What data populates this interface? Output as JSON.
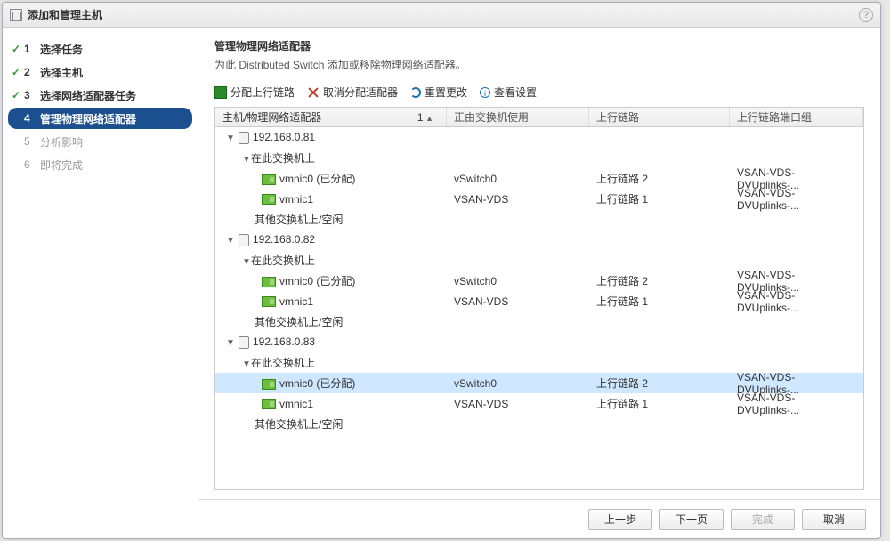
{
  "title": "添加和管理主机",
  "help": "?",
  "steps": [
    {
      "n": "1",
      "label": "选择任务",
      "state": "done"
    },
    {
      "n": "2",
      "label": "选择主机",
      "state": "done"
    },
    {
      "n": "3",
      "label": "选择网络适配器任务",
      "state": "done"
    },
    {
      "n": "4",
      "label": "管理物理网络适配器",
      "state": "current"
    },
    {
      "n": "5",
      "label": "分析影响",
      "state": "future"
    },
    {
      "n": "6",
      "label": "即将完成",
      "state": "future"
    }
  ],
  "heading": "管理物理网络适配器",
  "subheading": "为此 Distributed Switch 添加或移除物理网络适配器。",
  "toolbar": {
    "assign": "分配上行链路",
    "unassign": "取消分配适配器",
    "reset": "重置更改",
    "view": "查看设置"
  },
  "columns": {
    "c1": "主机/物理网络适配器",
    "sortnum": "1",
    "c2": "正由交换机使用",
    "c3": "上行链路",
    "c4": "上行链路端口组"
  },
  "labels": {
    "on_switch": "在此交换机上",
    "other_idle": "其他交换机上/空闲",
    "assigned_suffix": " (已分配)"
  },
  "hosts": [
    {
      "ip": "192.168.0.81",
      "nics": [
        {
          "name": "vmnic0",
          "assigned": true,
          "used": "vSwitch0",
          "uplink": "上行链路 2",
          "group": "VSAN-VDS-DVUplinks-..."
        },
        {
          "name": "vmnic1",
          "assigned": false,
          "used": "VSAN-VDS",
          "uplink": "上行链路 1",
          "group": "VSAN-VDS-DVUplinks-..."
        }
      ]
    },
    {
      "ip": "192.168.0.82",
      "nics": [
        {
          "name": "vmnic0",
          "assigned": true,
          "used": "vSwitch0",
          "uplink": "上行链路 2",
          "group": "VSAN-VDS-DVUplinks-..."
        },
        {
          "name": "vmnic1",
          "assigned": false,
          "used": "VSAN-VDS",
          "uplink": "上行链路 1",
          "group": "VSAN-VDS-DVUplinks-..."
        }
      ]
    },
    {
      "ip": "192.168.0.83",
      "selected_nic": "vmnic0",
      "nics": [
        {
          "name": "vmnic0",
          "assigned": true,
          "used": "vSwitch0",
          "uplink": "上行链路 2",
          "group": "VSAN-VDS-DVUplinks-..."
        },
        {
          "name": "vmnic1",
          "assigned": false,
          "used": "VSAN-VDS",
          "uplink": "上行链路 1",
          "group": "VSAN-VDS-DVUplinks-..."
        }
      ]
    }
  ],
  "buttons": {
    "back": "上一步",
    "next": "下一页",
    "finish": "完成",
    "cancel": "取消"
  }
}
